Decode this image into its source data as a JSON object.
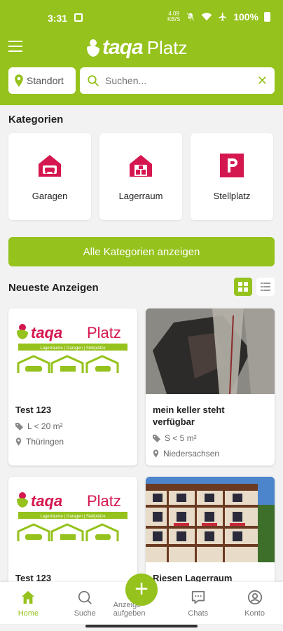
{
  "status_bar": {
    "time": "3:31",
    "network_speed_top": "4.09",
    "network_speed_bottom": "KB/S",
    "battery": "100%"
  },
  "header": {
    "logo_mark": "taqa",
    "logo_word": "Platz"
  },
  "location_button": {
    "label": "Standort"
  },
  "search": {
    "placeholder": "Suchen..."
  },
  "categories": {
    "title": "Kategorien",
    "items": [
      {
        "label": "Garagen",
        "icon": "garage-icon"
      },
      {
        "label": "Lagerraum",
        "icon": "storage-icon"
      },
      {
        "label": "Stellplatz",
        "icon": "parking-icon"
      }
    ],
    "all_button": "Alle Kategorien anzeigen"
  },
  "newest": {
    "title": "Neueste Anzeigen",
    "listings": [
      {
        "title": "Test 123",
        "size": "L < 20 m²",
        "location": "Thüringen",
        "image": "logo"
      },
      {
        "title": "mein keller steht verfügbar",
        "size": "S < 5 m²",
        "location": "Niedersachsen",
        "image": "cellar"
      },
      {
        "title": "Test 123",
        "image": "logo"
      },
      {
        "title": "Riesen Lagerraum",
        "image": "building"
      }
    ],
    "logo_tagline": "Lagerräume | Garagen | Stellplätze"
  },
  "bottom_nav": {
    "home": "Home",
    "search": "Suche",
    "post": "Anzeige aufgeben",
    "chats": "Chats",
    "account": "Konto"
  },
  "colors": {
    "brand": "#95c21c",
    "accent": "#d5174f"
  }
}
